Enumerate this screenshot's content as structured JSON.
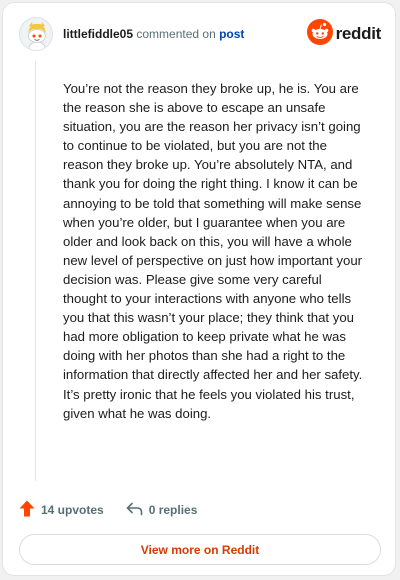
{
  "colors": {
    "brand_orange": "#ff4500",
    "link_blue": "#0045ac",
    "view_more": "#d93900",
    "muted": "#576f76"
  },
  "header": {
    "username": "littlefiddle05",
    "action_text": "commented on",
    "post_link": "post",
    "brand": "reddit",
    "avatar_icon": "snoo-avatar-icon",
    "brand_icon": "reddit-logo-icon"
  },
  "comment": {
    "body": "You’re not the reason they broke up, he is. You are the reason she is above to escape an unsafe situation, you are the reason her privacy isn’t going to continue to be violated, but you are not the reason they broke up. You’re absolutely NTA, and thank you for doing the right thing. I know it can be annoying to be told that something will make sense when you’re older, but I guarantee when you are older and look back on this, you will have a whole new level of perspective on just how important your decision was. Please give some very careful thought to your interactions with anyone who tells you that this wasn’t your place; they think that you had more obligation to keep private what he was doing with her photos than she had a right to the information that directly affected her and her safety. It’s pretty ironic that he feels you violated his trust, given what he was doing."
  },
  "footer": {
    "upvotes": "14 upvotes",
    "replies": "0 replies",
    "upvote_icon": "upvote-arrow-icon",
    "reply_icon": "reply-icon",
    "view_more": "View more on Reddit"
  }
}
